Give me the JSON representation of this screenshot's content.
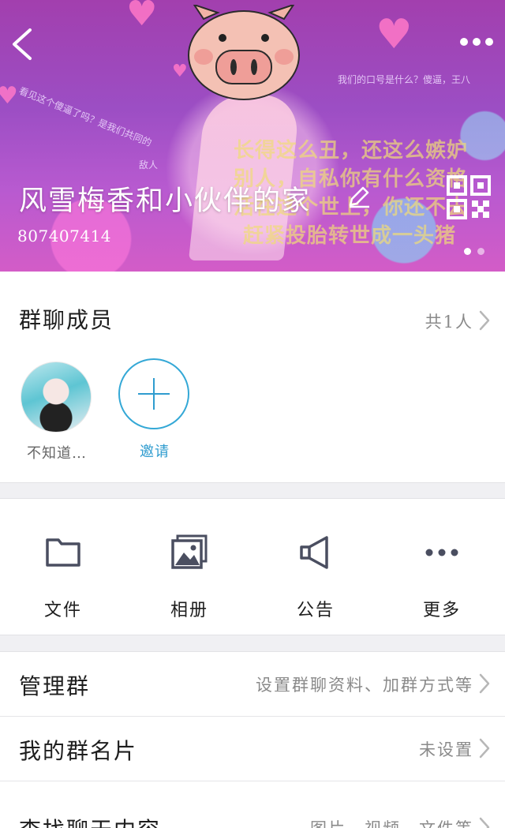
{
  "header": {
    "group_name": "风雪梅香和小伙伴的家",
    "group_id": "807407414",
    "deco_line1": "长得这么丑，还这么嫉妒",
    "deco_line2": "别人，自私你有什么资格",
    "deco_line3": "活在这个世上，你还不去",
    "deco_line4": "赶紧投胎转世成一头猪",
    "deco_small_left": "看见这个傻逼了吗？是我们共同的",
    "deco_small_left2": "敌人",
    "deco_small_right": "我们的口号是什么？傻逼，王八"
  },
  "members": {
    "title": "群聊成员",
    "count": "共1人",
    "list": [
      {
        "name": "不知道…"
      }
    ],
    "invite_label": "邀请"
  },
  "tools": [
    {
      "label": "文件",
      "icon": "folder-icon"
    },
    {
      "label": "相册",
      "icon": "album-icon"
    },
    {
      "label": "公告",
      "icon": "megaphone-icon"
    },
    {
      "label": "更多",
      "icon": "more-dots-icon"
    }
  ],
  "settings": [
    {
      "title": "管理群",
      "value": "设置群聊资料、加群方式等"
    },
    {
      "title": "我的群名片",
      "value": "未设置"
    },
    {
      "title": "查找聊天内容",
      "value": "图片、视频、文件等"
    }
  ],
  "colors": {
    "accent": "#2f9ccf",
    "banner": "#a74dc4"
  }
}
